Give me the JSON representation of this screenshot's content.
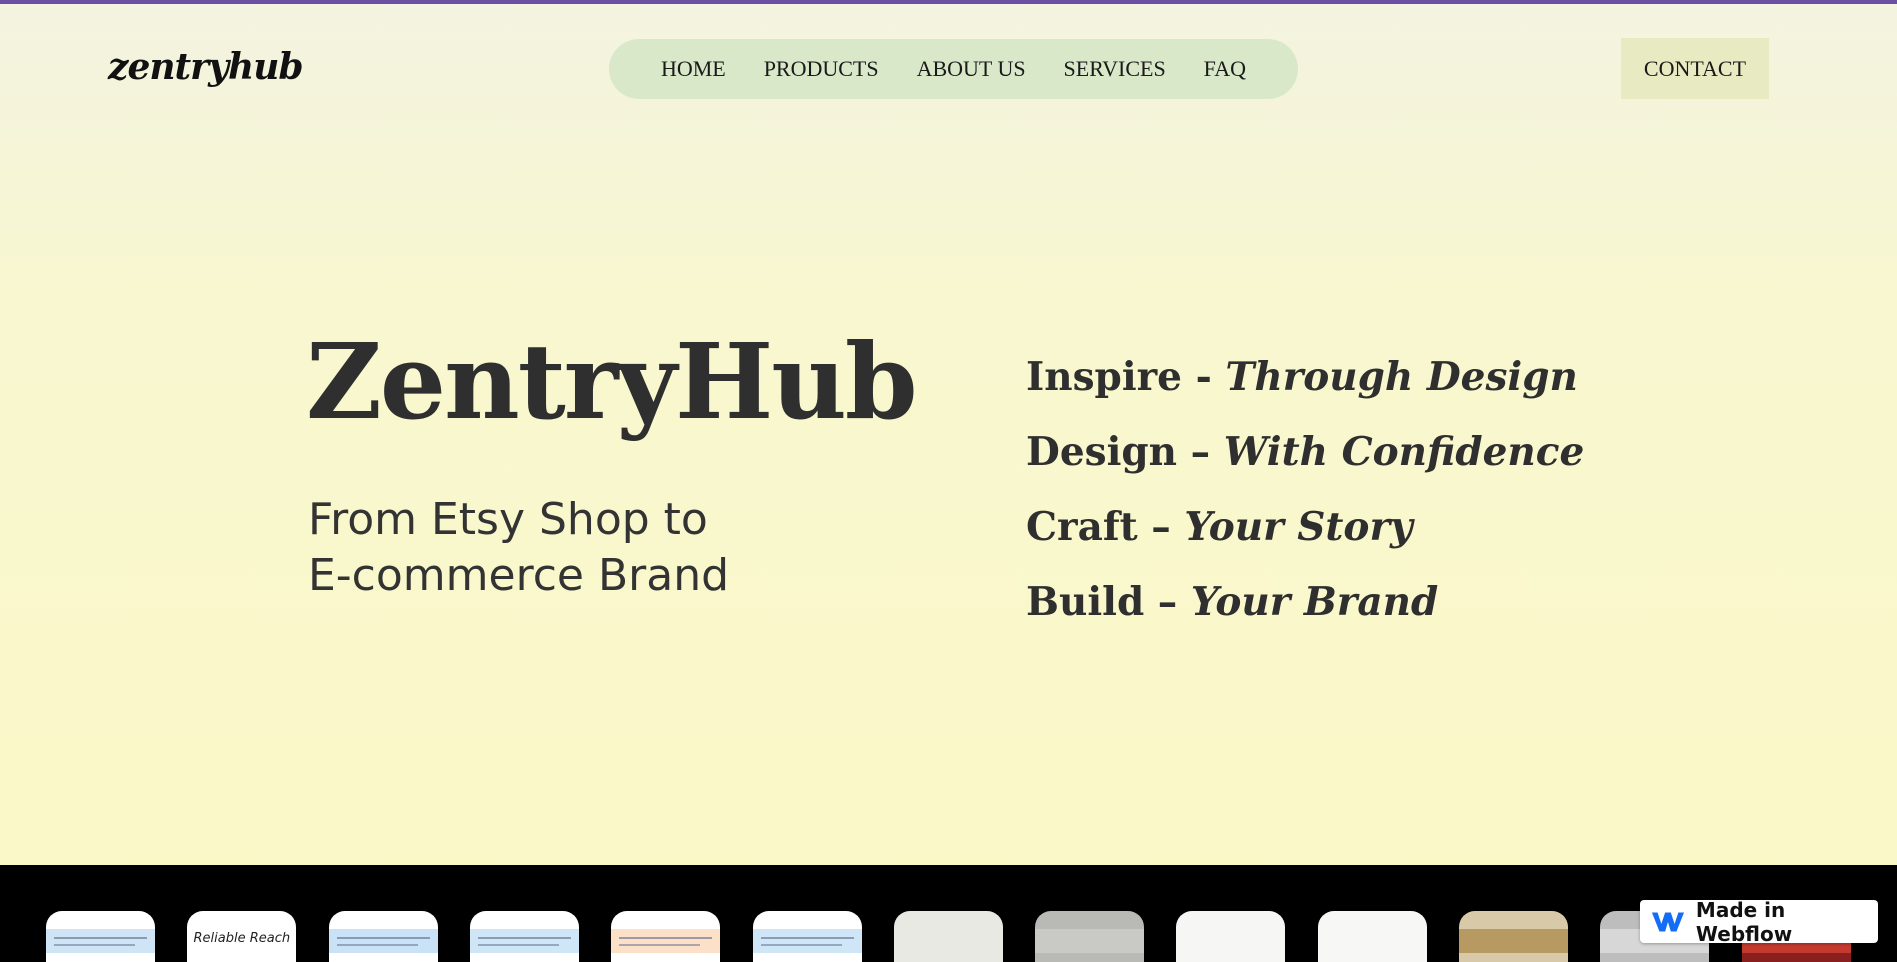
{
  "header": {
    "logo": "zentryhub",
    "nav": [
      "HOME",
      "PRODUCTS",
      "ABOUT US",
      "SERVICES",
      "FAQ"
    ],
    "contact": "CONTACT"
  },
  "hero": {
    "title": "ZentryHub",
    "subtitle_line1": "From Etsy Shop to",
    "subtitle_line2": "E-commerce Brand",
    "taglines": [
      {
        "lead": "Inspire - ",
        "emph": "Through Design"
      },
      {
        "lead": "Design – ",
        "emph": "With Confidence"
      },
      {
        "lead": "Craft – ",
        "emph": "Your Story"
      },
      {
        "lead": "Build – ",
        "emph": "Your Brand"
      }
    ]
  },
  "strip": {
    "thumbs": [
      {
        "bg": "#ffffff",
        "band": "#cfe4f5",
        "text": ""
      },
      {
        "bg": "#ffffff",
        "band": "#ffffff",
        "text": "Reliable Reach"
      },
      {
        "bg": "#ffffff",
        "band": "#c9e2f6",
        "text": ""
      },
      {
        "bg": "#ffffff",
        "band": "#cfe6f7",
        "text": ""
      },
      {
        "bg": "#ffffff",
        "band": "#fde0c8",
        "text": ""
      },
      {
        "bg": "#ffffff",
        "band": "#cfe6f7",
        "text": ""
      },
      {
        "bg": "#e9e9e4",
        "band": "#e9e9e4",
        "text": ""
      },
      {
        "bg": "#b9b9b6",
        "band": "#c9c9c5",
        "text": ""
      },
      {
        "bg": "#f6f6f4",
        "band": "#f6f6f4",
        "text": ""
      },
      {
        "bg": "#f7f7f5",
        "band": "#f7f7f5",
        "text": ""
      },
      {
        "bg": "#d8c9a8",
        "band": "#b79a62",
        "text": ""
      },
      {
        "bg": "#bdbdbd",
        "band": "#d7d7d7",
        "text": ""
      },
      {
        "bg": "#8a1f1f",
        "band": "#c43a2f",
        "text": ""
      }
    ],
    "badge": "Made in Webflow"
  },
  "colors": {
    "accent_bar": "#6b4fa3",
    "nav_pill": "#d8e8c9",
    "contact_bg": "#e8ebc2",
    "strip_bg": "#000000",
    "webflow_blue": "#146ef5"
  }
}
